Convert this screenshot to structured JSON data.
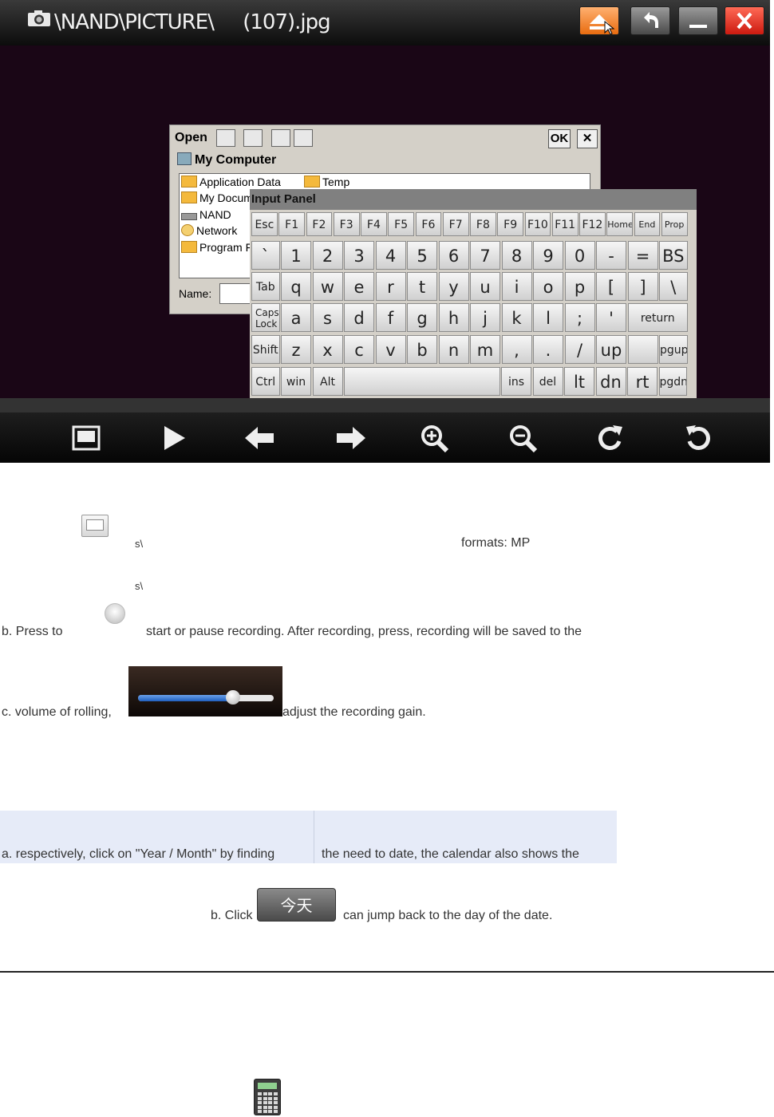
{
  "viewer": {
    "title_path": "\\NAND\\PICTURE\\     (107).jpg",
    "title_buttons": [
      "eject-icon",
      "back-arrow-icon",
      "minimize-icon",
      "close-icon"
    ],
    "toolbar_icons": [
      "slideshow-frame-icon",
      "play-icon",
      "previous-arrow-icon",
      "next-arrow-icon",
      "zoom-in-icon",
      "zoom-out-icon",
      "rotate-clockwise-icon",
      "rotate-counterclockwise-icon"
    ]
  },
  "open_dialog": {
    "label": "Open",
    "ok": "OK",
    "close": "✕",
    "location": "My Computer",
    "items": [
      {
        "label": "Application Data",
        "icon": "folder-icon"
      },
      {
        "label": "Temp",
        "icon": "folder-icon"
      },
      {
        "label": "My Docum",
        "icon": "folder-icon"
      },
      {
        "label": "NAND",
        "icon": "drive-icon"
      },
      {
        "label": "Network",
        "icon": "network-icon"
      },
      {
        "label": "Program F",
        "icon": "folder-icon"
      }
    ],
    "name_label": "Name:"
  },
  "input_panel": {
    "title": "Input Panel",
    "rows": [
      [
        "Esc",
        "F1",
        "F2",
        "F3",
        "F4",
        "F5",
        "F6",
        "F7",
        "F8",
        "F9",
        "F10",
        "F11",
        "F12",
        "Home",
        "End",
        "Prop"
      ],
      [
        "`",
        "1",
        "2",
        "3",
        "4",
        "5",
        "6",
        "7",
        "8",
        "9",
        "0",
        "-",
        "=",
        "BS"
      ],
      [
        "Tab",
        "q",
        "w",
        "e",
        "r",
        "t",
        "y",
        "u",
        "i",
        "o",
        "p",
        "[",
        "]",
        "\\"
      ],
      [
        "Caps Lock",
        "a",
        "s",
        "d",
        "f",
        "g",
        "h",
        "j",
        "k",
        "l",
        ";",
        "'",
        "return"
      ],
      [
        "Shift",
        "z",
        "x",
        "c",
        "v",
        "b",
        "n",
        "m",
        ",",
        ".",
        "/",
        "up",
        "",
        "pgup"
      ],
      [
        "Ctrl",
        "win",
        "Alt",
        "",
        "ins",
        "del",
        "lt",
        "dn",
        "rt",
        "pgdn"
      ]
    ]
  },
  "doc": {
    "line1_left": "s\\",
    "line1_right": "formats: MP",
    "line2": "s\\",
    "b_press": "b. Press to",
    "b_rest": "start  or  pause  recording.  After  recording,  press,  recording  will  be  saved  to  the",
    "c_left": "c. volume of rolling,",
    "c_right": "adjust the recording gain.",
    "slider_value": 0.7,
    "a_left": "a. respectively, click on \"Year / Month\" by finding",
    "a_right": "the  need  to  date,  the  calendar  also  shows  the",
    "b2_left": "b. Click",
    "today_label": "今天",
    "b2_right": "can jump back to the day of the date."
  }
}
